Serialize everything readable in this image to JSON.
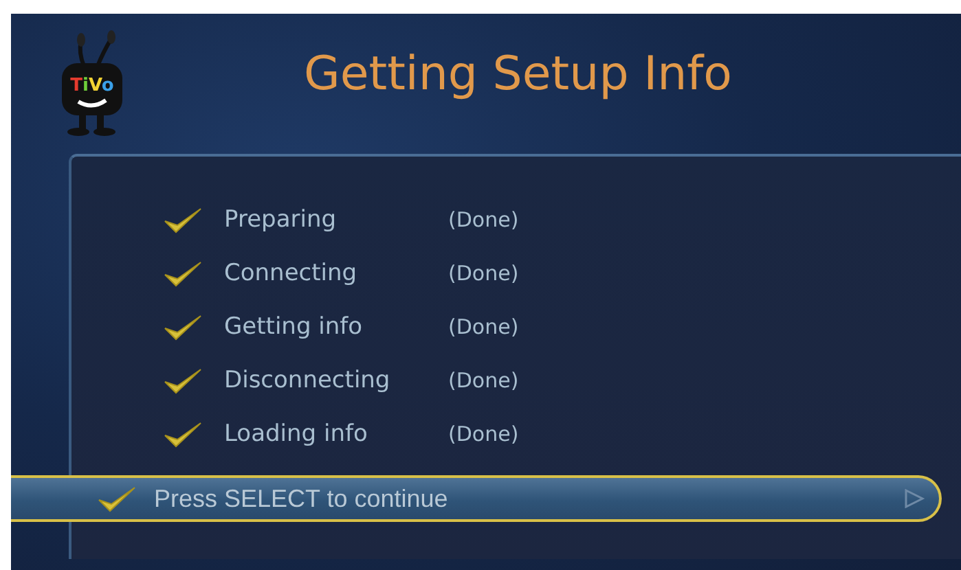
{
  "logo": {
    "text": "TiVo"
  },
  "title": "Getting Setup Info",
  "steps": [
    {
      "label": "Preparing",
      "status": "(Done)",
      "checked": true
    },
    {
      "label": "Connecting",
      "status": "(Done)",
      "checked": true
    },
    {
      "label": "Getting info",
      "status": "(Done)",
      "checked": true
    },
    {
      "label": "Disconnecting",
      "status": "(Done)",
      "checked": true
    },
    {
      "label": "Loading info",
      "status": "(Done)",
      "checked": true
    }
  ],
  "action": {
    "label": "Press SELECT to continue",
    "selected": true
  }
}
